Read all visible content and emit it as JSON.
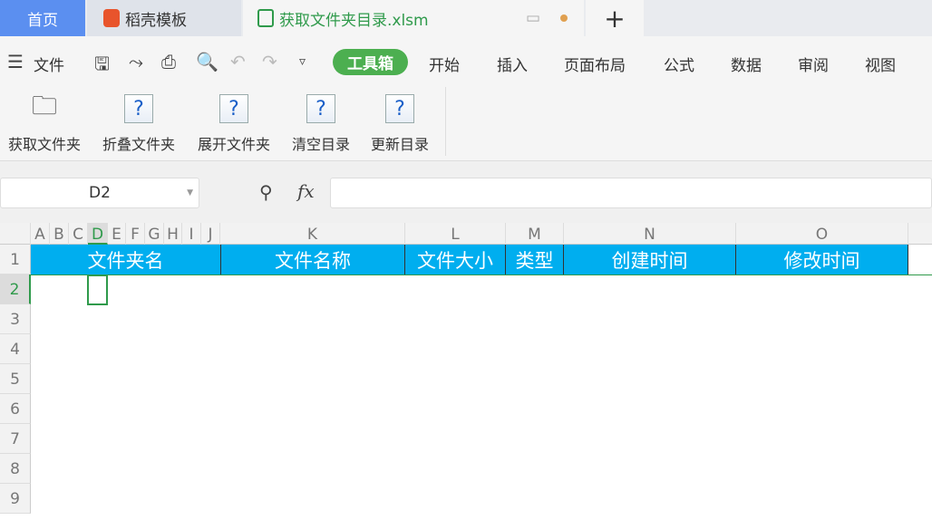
{
  "tabs": {
    "home": "首页",
    "template": "稻壳模板",
    "file": "获取文件夹目录.xlsm",
    "add": "+"
  },
  "menu": {
    "file": "文件",
    "items": [
      "工具箱",
      "开始",
      "插入",
      "页面布局",
      "公式",
      "数据",
      "审阅",
      "视图"
    ]
  },
  "ribbon": [
    "获取文件夹",
    "折叠文件夹",
    "展开文件夹",
    "清空目录",
    "更新目录"
  ],
  "formula_bar": {
    "cell_ref": "D2",
    "fx": "fx",
    "value": ""
  },
  "columns": [
    "A",
    "B",
    "C",
    "D",
    "E",
    "F",
    "G",
    "H",
    "I",
    "J",
    "K",
    "L",
    "M",
    "N",
    "O"
  ],
  "rows": [
    "1",
    "2",
    "3",
    "4",
    "5",
    "6",
    "7",
    "8",
    "9"
  ],
  "header_cells": [
    "文件夹名",
    "文件名称",
    "文件大小",
    "类型",
    "创建时间",
    "修改时间"
  ],
  "colors": {
    "accent": "#4caf50",
    "header_fill": "#00aeef",
    "home_tab": "#5b8ff0"
  }
}
